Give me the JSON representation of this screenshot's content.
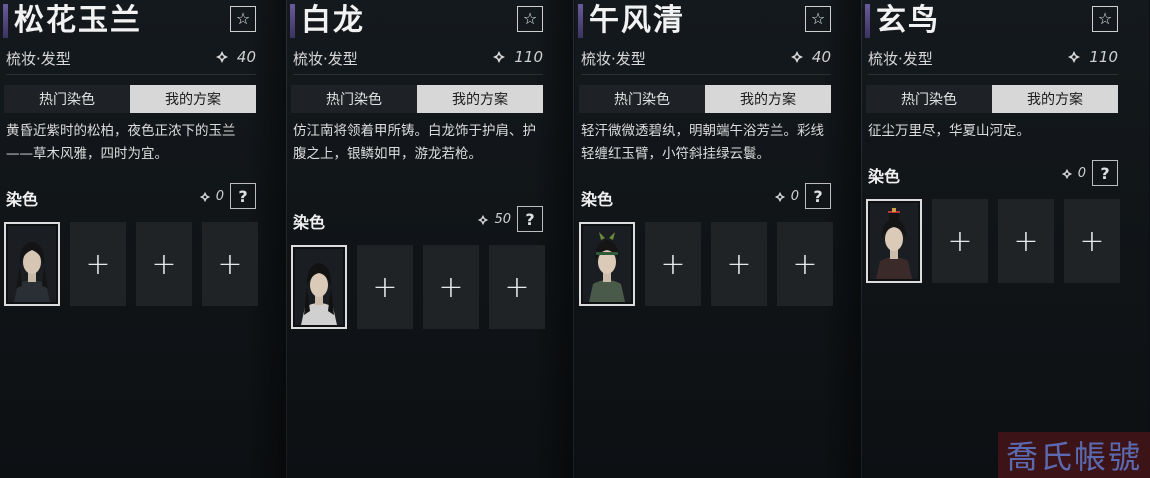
{
  "cards": [
    {
      "title": "松花玉兰",
      "subtitle": "梳妆·发型",
      "cost": "40",
      "tabs": [
        "热门染色",
        "我的方案"
      ],
      "description": "黄昏近紫时的松柏，夜色正浓下的玉兰——草木风雅，四时为宜。",
      "dye_label": "染色",
      "dye_cost": "0",
      "help_label": "?"
    },
    {
      "title": "白龙",
      "subtitle": "梳妆·发型",
      "cost": "110",
      "tabs": [
        "热门染色",
        "我的方案"
      ],
      "description": "仿江南将领着甲所铸。白龙饰于护肩、护腹之上，银鳞如甲，游龙若枪。",
      "dye_label": "染色",
      "dye_cost": "50",
      "help_label": "?"
    },
    {
      "title": "午风清",
      "subtitle": "梳妆·发型",
      "cost": "40",
      "tabs": [
        "热门染色",
        "我的方案"
      ],
      "description": "轻汗微微透碧纨，明朝端午浴芳兰。彩线轻缠红玉臂，小符斜挂绿云鬟。",
      "dye_label": "染色",
      "dye_cost": "0",
      "help_label": "?"
    },
    {
      "title": "玄鸟",
      "subtitle": "梳妆·发型",
      "cost": "110",
      "tabs": [
        "热门染色",
        "我的方案"
      ],
      "description": "征尘万里尽，华夏山河定。",
      "dye_label": "染色",
      "dye_cost": "0",
      "help_label": "?"
    }
  ],
  "icons": {
    "favorite": "star-icon",
    "currency": "gem-icon",
    "add_slot": "plus-icon"
  },
  "slot_add_symbol": "+",
  "star_symbol": "☆",
  "watermark": "喬氏帳號",
  "colors": {
    "accent_bar": "#6a5a9a",
    "active_tab": "#d7d7d7",
    "watermark_bg": "#3c1418",
    "watermark_text": "#5b6ab0"
  }
}
